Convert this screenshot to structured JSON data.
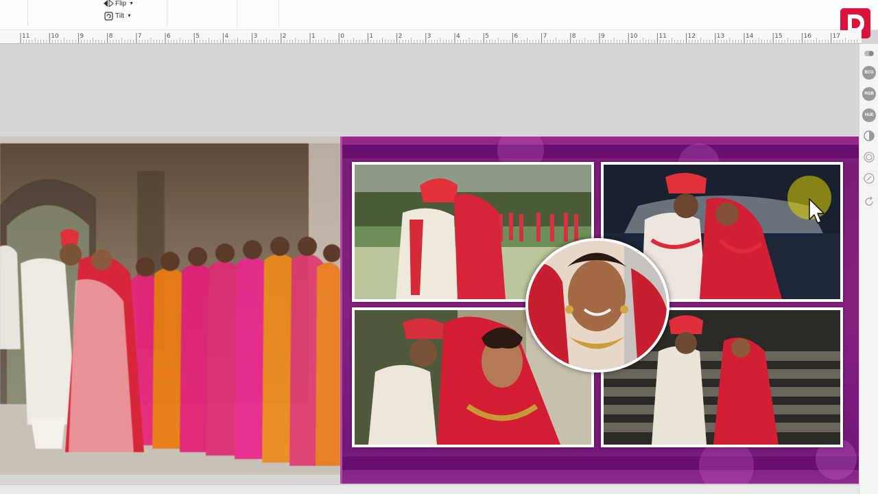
{
  "toolbar": {
    "flip_label": "Flip",
    "tilt_label": "Tilt",
    "flip_icon": "flip-icon",
    "tilt_icon": "tilt-icon"
  },
  "brand": {
    "logo_letter": "D",
    "color": "#d9133c"
  },
  "ruler": {
    "ticks": [
      "11",
      "10",
      "9",
      "8",
      "7",
      "6",
      "5",
      "4",
      "3",
      "2",
      "1",
      "0",
      "1",
      "2",
      "3",
      "4",
      "5",
      "6",
      "7",
      "8",
      "9",
      "10",
      "11",
      "12",
      "13",
      "14",
      "15",
      "16",
      "17"
    ]
  },
  "side_tools": [
    {
      "name": "toggle-icon",
      "label": ""
    },
    {
      "name": "bcg-button",
      "label": "BCG"
    },
    {
      "name": "rgb-button",
      "label": "RGB"
    },
    {
      "name": "hue-button",
      "label": "HUE"
    },
    {
      "name": "contrast-icon",
      "label": ""
    },
    {
      "name": "vignette-icon",
      "label": ""
    },
    {
      "name": "sharpen-icon",
      "label": ""
    },
    {
      "name": "reset-icon",
      "label": ""
    }
  ],
  "colors": {
    "page_purple": "#7a1c78",
    "band_purple": "#6a0f6e",
    "accent_red": "#d9133c",
    "cursor_halo": "#e2d600"
  }
}
